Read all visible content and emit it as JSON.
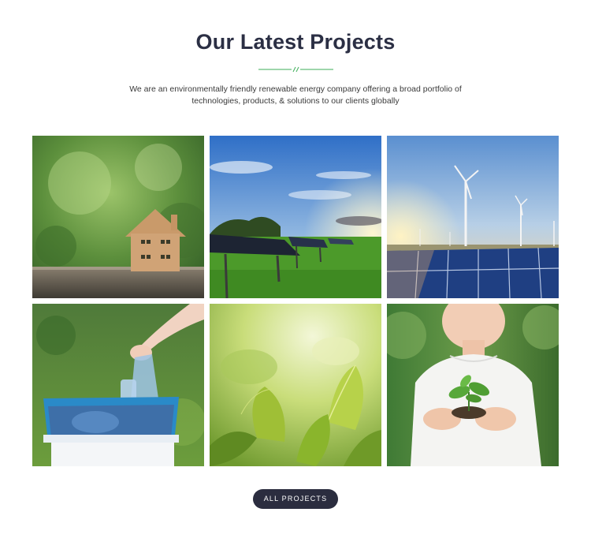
{
  "section": {
    "title": "Our Latest Projects",
    "subtitle": "We are an environmentally friendly renewable energy company offering a broad portfolio of technologies, products, & solutions to our clients globally"
  },
  "projects": [
    {
      "image": "wooden-house-model-on-log"
    },
    {
      "image": "solar-panels-in-field-at-sunset"
    },
    {
      "image": "wind-turbines-and-solar-panels"
    },
    {
      "image": "hand-recycling-plastic-bottles"
    },
    {
      "image": "green-leaves-in-sunlight"
    },
    {
      "image": "child-holding-seedling"
    }
  ],
  "cta": {
    "label": "ALL PROJECTS"
  },
  "colors": {
    "title": "#2b2f44",
    "divider": "#3dae5a",
    "button": "#2b2d3f"
  }
}
